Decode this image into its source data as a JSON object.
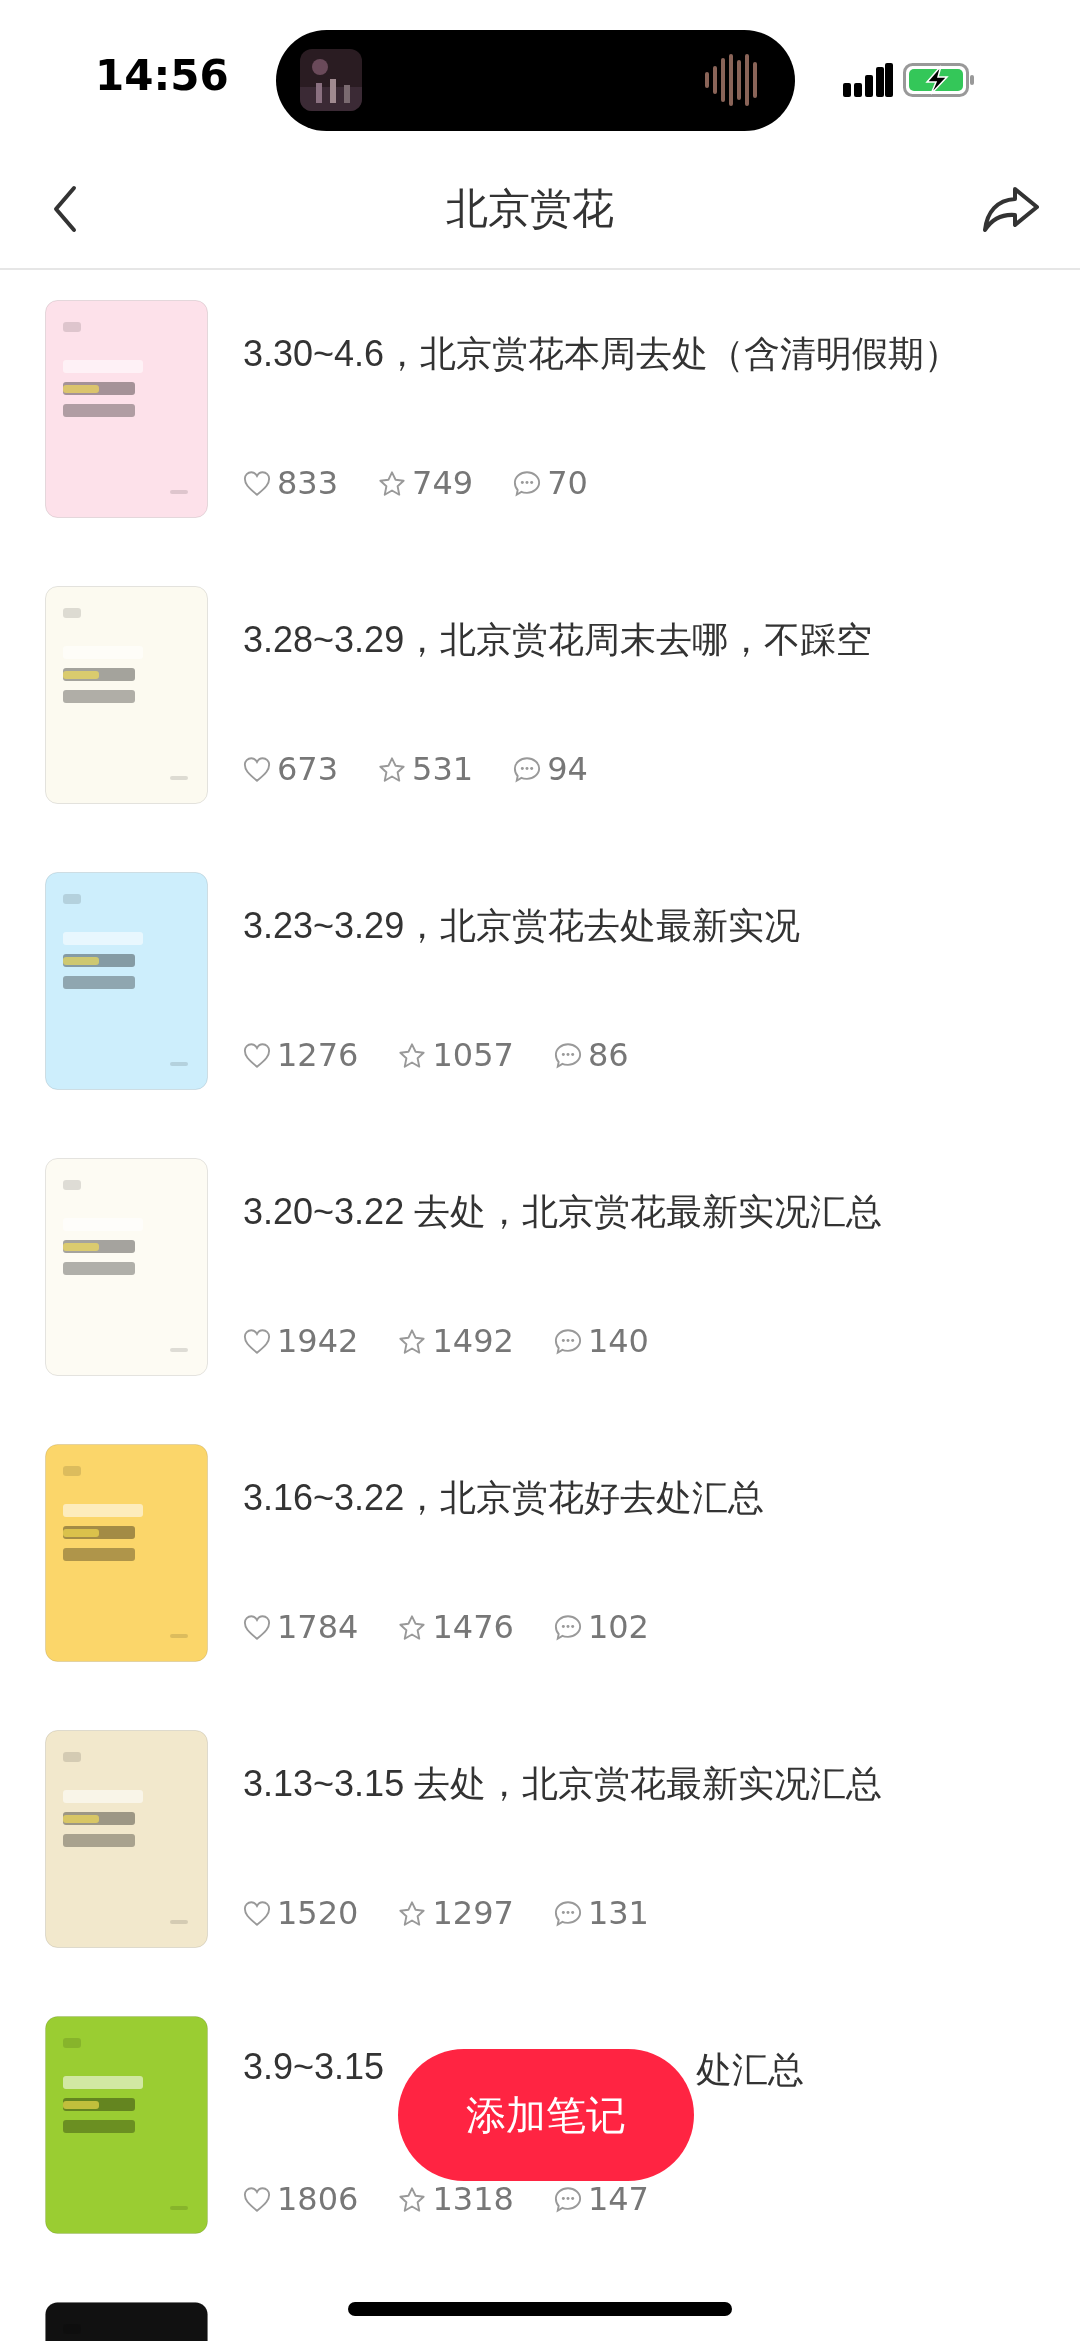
{
  "status_bar": {
    "time": "14:56"
  },
  "nav": {
    "title": "北京赏花"
  },
  "notes": [
    {
      "title": "3.30~4.6，北京赏花本周去处（含清明假期）",
      "likes": "833",
      "favorites": "749",
      "comments": "70",
      "thumbnail": {
        "kind": "picture",
        "color": "#fde1ea"
      }
    },
    {
      "title": "3.28~3.29，北京赏花周末去哪，不踩空",
      "likes": "673",
      "favorites": "531",
      "comments": "94",
      "thumbnail": {
        "kind": "picture",
        "color": "#fcfaf0"
      }
    },
    {
      "title": "3.23~3.29，北京赏花去处最新实况",
      "likes": "1276",
      "favorites": "1057",
      "comments": "86",
      "thumbnail": {
        "kind": "picture",
        "color": "#cdeefc"
      }
    },
    {
      "title": "3.20~3.22 去处，北京赏花最新实况汇总",
      "likes": "1942",
      "favorites": "1492",
      "comments": "140",
      "thumbnail": {
        "kind": "picture",
        "color": "#fdfbf3"
      }
    },
    {
      "title": "3.16~3.22，北京赏花好去处汇总",
      "likes": "1784",
      "favorites": "1476",
      "comments": "102",
      "thumbnail": {
        "kind": "picture",
        "color": "#fbd66a"
      }
    },
    {
      "title": "3.13~3.15 去处，北京赏花最新实况汇总",
      "likes": "1520",
      "favorites": "1297",
      "comments": "131",
      "thumbnail": {
        "kind": "picture",
        "color": "#f2e8cc"
      }
    },
    {
      "title_start": "3.9~3.15",
      "title_end": "处汇总",
      "likes": "1806",
      "favorites": "1318",
      "comments": "147",
      "thumbnail": {
        "kind": "picture",
        "color": "#9acd32"
      }
    },
    {
      "thumbnail": {
        "kind": "picture",
        "color": "#111111"
      }
    }
  ],
  "add_button": {
    "label": "添加笔记"
  }
}
